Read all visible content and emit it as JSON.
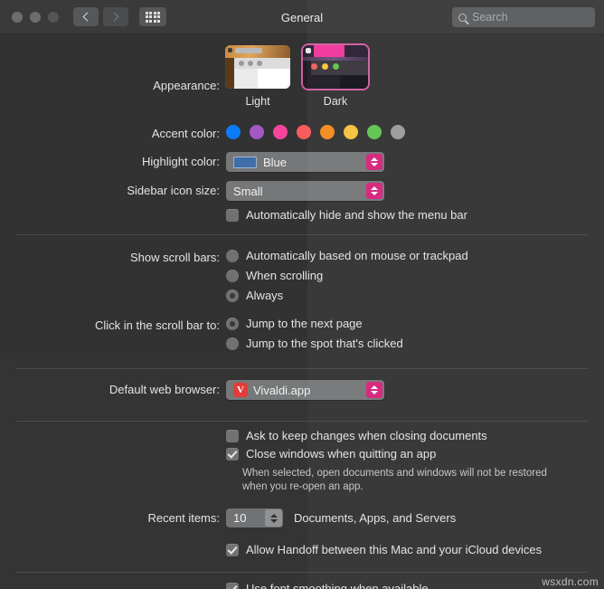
{
  "window": {
    "title": "General",
    "traffic_lights": [
      "close",
      "minimize",
      "zoom"
    ],
    "nav_back": "back",
    "nav_forward": "forward",
    "grid_button": "show-all",
    "search_placeholder": "Search"
  },
  "appearance": {
    "label": "Appearance:",
    "options": [
      {
        "name": "Light",
        "selected": false
      },
      {
        "name": "Dark",
        "selected": true
      }
    ]
  },
  "accent_color": {
    "label": "Accent color:",
    "swatches": [
      {
        "name": "blue",
        "hex": "#0a7cf7",
        "selected": true
      },
      {
        "name": "purple",
        "hex": "#a358c6"
      },
      {
        "name": "pink",
        "hex": "#f7459c"
      },
      {
        "name": "red",
        "hex": "#f85a5e"
      },
      {
        "name": "orange",
        "hex": "#f58a20"
      },
      {
        "name": "yellow",
        "hex": "#f6c13c"
      },
      {
        "name": "green",
        "hex": "#5fc44e"
      },
      {
        "name": "graphite",
        "hex": "#9b9b9b"
      }
    ]
  },
  "highlight_color": {
    "label": "Highlight color:",
    "value": "Blue",
    "swatch_hex": "#3f6ea8"
  },
  "sidebar_icon_size": {
    "label": "Sidebar icon size:",
    "value": "Small"
  },
  "menu_bar": {
    "checkbox_label": "Automatically hide and show the menu bar",
    "checked": false
  },
  "scroll_bars": {
    "label": "Show scroll bars:",
    "options": [
      {
        "label": "Automatically based on mouse or trackpad",
        "selected": false
      },
      {
        "label": "When scrolling",
        "selected": false
      },
      {
        "label": "Always",
        "selected": true
      }
    ]
  },
  "scroll_bar_click": {
    "label": "Click in the scroll bar to:",
    "options": [
      {
        "label": "Jump to the next page",
        "selected": true
      },
      {
        "label": "Jump to the spot that's clicked",
        "selected": false
      }
    ]
  },
  "default_browser": {
    "label": "Default web browser:",
    "value": "Vivaldi.app",
    "icon_glyph": "V",
    "icon_hex": "#e23b37"
  },
  "documents": {
    "ask_keep_changes": {
      "label": "Ask to keep changes when closing documents",
      "checked": false
    },
    "close_windows": {
      "label": "Close windows when quitting an app",
      "checked": true
    },
    "help_line1": "When selected, open documents and windows will not be restored",
    "help_line2": "when you re-open an app."
  },
  "recent_items": {
    "label": "Recent items:",
    "value": "10",
    "suffix": "Documents, Apps, and Servers"
  },
  "handoff": {
    "label": "Allow Handoff between this Mac and your iCloud devices",
    "checked": true
  },
  "font_smoothing": {
    "label": "Use font smoothing when available",
    "checked": true
  },
  "watermark": "wsxdn.com"
}
